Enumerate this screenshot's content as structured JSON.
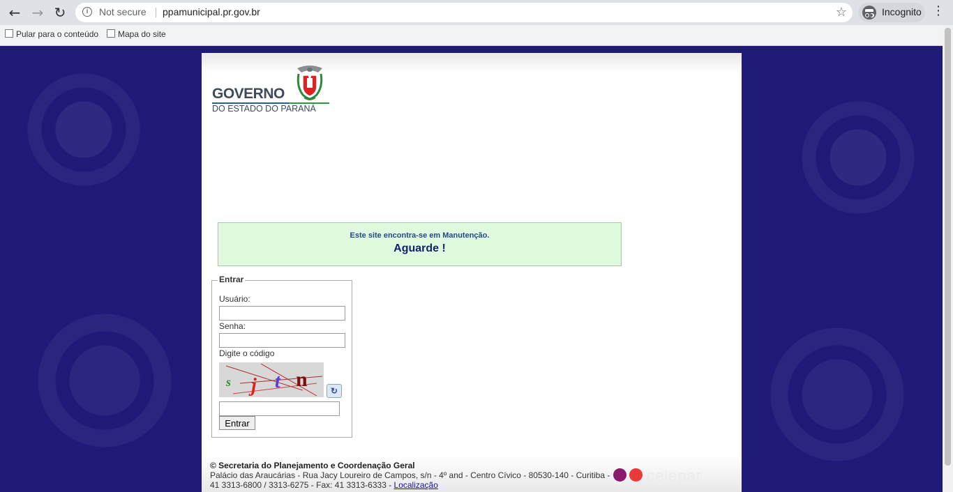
{
  "browser": {
    "omnibox": {
      "security": "Not secure",
      "url": "ppamunicipal.pr.gov.br"
    },
    "incognito_label": "Incognito",
    "icons": [
      "back-arrow-icon",
      "forward-arrow-icon",
      "reload-icon",
      "info-icon",
      "star-icon",
      "incognito-icon",
      "menu-icon"
    ]
  },
  "bookmarks": [
    {
      "label": "Pular para o conteúdo"
    },
    {
      "label": "Mapa do site"
    }
  ],
  "logo": {
    "line1": "GOVERNO",
    "line2": "DO ESTADO DO PARANÁ"
  },
  "maintenance": {
    "message": "Este site encontra-se em Manutenção.",
    "wait": "Aguarde !"
  },
  "login": {
    "legend": "Entrar",
    "user_label": "Usuário:",
    "user_value": "",
    "password_label": "Senha:",
    "password_value": "",
    "captcha_label": "Digite o código",
    "captcha_chars": [
      "s",
      "j",
      "t",
      "n"
    ],
    "captcha_value": "",
    "submit": "Entrar"
  },
  "footer": {
    "org": "© Secretaria do Planejamento e Coordenação Geral",
    "address": "Palácio das Araucárias - Rua Jacy Loureiro de Campos, s/n - 4º and - Centro Cívico - 80530-140 - Curitiba -",
    "phones": "41 3313-6800 / 3313-6275 - Fax: 41 3313-6333 - ",
    "location_link": "Localização",
    "partner": "celepar"
  },
  "colors": {
    "page_bg": "#1e1a78",
    "maint_bg": "#e0fae0",
    "maint_title": "#14216b",
    "celepar_dot1": "#8b1a6b",
    "celepar_dot2": "#e83a3a"
  }
}
